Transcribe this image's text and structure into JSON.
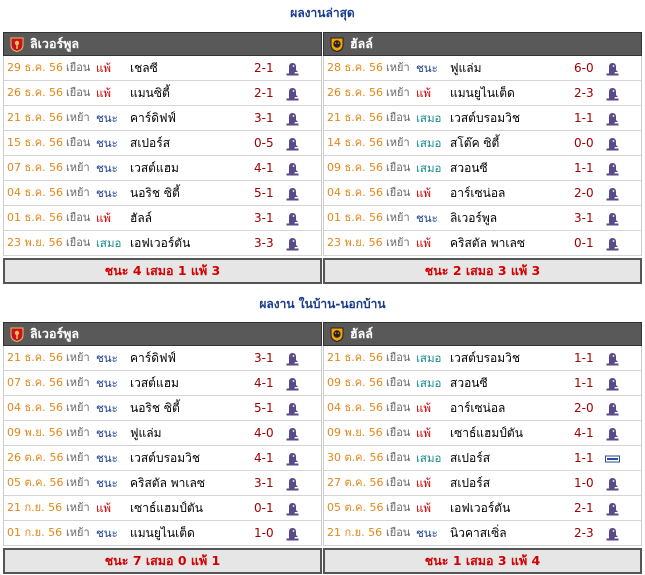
{
  "colors": {
    "title": "#1a3c8c",
    "header_bg": "#595959",
    "date": "#e0881a",
    "win": "#1a3c8c",
    "loss": "#d40000",
    "draw": "#1a8c8c",
    "score": "#a00000",
    "summary_text": "#d40000"
  },
  "sections": [
    {
      "title": "ผลงานล่าสุด",
      "panels": [
        {
          "team": "ลิเวอร์พูล",
          "crest_icon": "liverpool-crest-icon",
          "rows": [
            {
              "date": "29 ธ.ค. 56",
              "ha": "เยือน",
              "result": "แพ้",
              "type": "loss",
              "opponent": "เชลซี",
              "score": "2-1",
              "icon": "premier-league-icon"
            },
            {
              "date": "26 ธ.ค. 56",
              "ha": "เยือน",
              "result": "แพ้",
              "type": "loss",
              "opponent": "แมนซิตี้",
              "score": "2-1",
              "icon": "premier-league-icon"
            },
            {
              "date": "21 ธ.ค. 56",
              "ha": "เหย้า",
              "result": "ชนะ",
              "type": "win",
              "opponent": "คาร์ดิฟฟ์",
              "score": "3-1",
              "icon": "premier-league-icon"
            },
            {
              "date": "15 ธ.ค. 56",
              "ha": "เยือน",
              "result": "ชนะ",
              "type": "win",
              "opponent": "สเปอร์ส",
              "score": "0-5",
              "icon": "premier-league-icon"
            },
            {
              "date": "07 ธ.ค. 56",
              "ha": "เหย้า",
              "result": "ชนะ",
              "type": "win",
              "opponent": "เวสต์แฮม",
              "score": "4-1",
              "icon": "premier-league-icon"
            },
            {
              "date": "04 ธ.ค. 56",
              "ha": "เหย้า",
              "result": "ชนะ",
              "type": "win",
              "opponent": "นอริช ซิตี้",
              "score": "5-1",
              "icon": "premier-league-icon"
            },
            {
              "date": "01 ธ.ค. 56",
              "ha": "เยือน",
              "result": "แพ้",
              "type": "loss",
              "opponent": "ฮัลล์",
              "score": "3-1",
              "icon": "premier-league-icon"
            },
            {
              "date": "23 พ.ย. 56",
              "ha": "เยือน",
              "result": "เสมอ",
              "type": "draw",
              "opponent": "เอฟเวอร์ตัน",
              "score": "3-3",
              "icon": "premier-league-icon"
            }
          ],
          "summary": "ชนะ 4 เสมอ 1 แพ้ 3"
        },
        {
          "team": "ฮัลล์",
          "crest_icon": "hull-crest-icon",
          "rows": [
            {
              "date": "28 ธ.ค. 56",
              "ha": "เหย้า",
              "result": "ชนะ",
              "type": "win",
              "opponent": "ฟูแล่ม",
              "score": "6-0",
              "icon": "premier-league-icon"
            },
            {
              "date": "26 ธ.ค. 56",
              "ha": "เหย้า",
              "result": "แพ้",
              "type": "loss",
              "opponent": "แมนยูไนเต็ด",
              "score": "2-3",
              "icon": "premier-league-icon"
            },
            {
              "date": "21 ธ.ค. 56",
              "ha": "เยือน",
              "result": "เสมอ",
              "type": "draw",
              "opponent": "เวสต์บรอมวิช",
              "score": "1-1",
              "icon": "premier-league-icon"
            },
            {
              "date": "14 ธ.ค. 56",
              "ha": "เหย้า",
              "result": "เสมอ",
              "type": "draw",
              "opponent": "สโต๊ค ซิตี้",
              "score": "0-0",
              "icon": "premier-league-icon"
            },
            {
              "date": "09 ธ.ค. 56",
              "ha": "เยือน",
              "result": "เสมอ",
              "type": "draw",
              "opponent": "สวอนซี",
              "score": "1-1",
              "icon": "premier-league-icon"
            },
            {
              "date": "04 ธ.ค. 56",
              "ha": "เยือน",
              "result": "แพ้",
              "type": "loss",
              "opponent": "อาร์เซน่อล",
              "score": "2-0",
              "icon": "premier-league-icon"
            },
            {
              "date": "01 ธ.ค. 56",
              "ha": "เหย้า",
              "result": "ชนะ",
              "type": "win",
              "opponent": "ลิเวอร์พูล",
              "score": "3-1",
              "icon": "premier-league-icon"
            },
            {
              "date": "23 พ.ย. 56",
              "ha": "เหย้า",
              "result": "แพ้",
              "type": "loss",
              "opponent": "คริสตัล พาเลซ",
              "score": "0-1",
              "icon": "premier-league-icon"
            }
          ],
          "summary": "ชนะ 2 เสมอ 3 แพ้ 3"
        }
      ]
    },
    {
      "title": "ผลงาน ในบ้าน-นอกบ้าน",
      "panels": [
        {
          "team": "ลิเวอร์พูล",
          "crest_icon": "liverpool-crest-icon",
          "rows": [
            {
              "date": "21 ธ.ค. 56",
              "ha": "เหย้า",
              "result": "ชนะ",
              "type": "win",
              "opponent": "คาร์ดิฟฟ์",
              "score": "3-1",
              "icon": "premier-league-icon"
            },
            {
              "date": "07 ธ.ค. 56",
              "ha": "เหย้า",
              "result": "ชนะ",
              "type": "win",
              "opponent": "เวสต์แฮม",
              "score": "4-1",
              "icon": "premier-league-icon"
            },
            {
              "date": "04 ธ.ค. 56",
              "ha": "เหย้า",
              "result": "ชนะ",
              "type": "win",
              "opponent": "นอริช ซิตี้",
              "score": "5-1",
              "icon": "premier-league-icon"
            },
            {
              "date": "09 พ.ย. 56",
              "ha": "เหย้า",
              "result": "ชนะ",
              "type": "win",
              "opponent": "ฟูแล่ม",
              "score": "4-0",
              "icon": "premier-league-icon"
            },
            {
              "date": "26 ต.ค. 56",
              "ha": "เหย้า",
              "result": "ชนะ",
              "type": "win",
              "opponent": "เวสต์บรอมวิช",
              "score": "4-1",
              "icon": "premier-league-icon"
            },
            {
              "date": "05 ต.ค. 56",
              "ha": "เหย้า",
              "result": "ชนะ",
              "type": "win",
              "opponent": "คริสตัล พาเลซ",
              "score": "3-1",
              "icon": "premier-league-icon"
            },
            {
              "date": "21 ก.ย. 56",
              "ha": "เหย้า",
              "result": "แพ้",
              "type": "loss",
              "opponent": "เซาธ์แฮมป์ตัน",
              "score": "0-1",
              "icon": "premier-league-icon"
            },
            {
              "date": "01 ก.ย. 56",
              "ha": "เหย้า",
              "result": "ชนะ",
              "type": "win",
              "opponent": "แมนยูไนเต็ด",
              "score": "1-0",
              "icon": "premier-league-icon"
            }
          ],
          "summary": "ชนะ 7 เสมอ 0 แพ้ 1"
        },
        {
          "team": "ฮัลล์",
          "crest_icon": "hull-crest-icon",
          "rows": [
            {
              "date": "21 ธ.ค. 56",
              "ha": "เยือน",
              "result": "เสมอ",
              "type": "draw",
              "opponent": "เวสต์บรอมวิช",
              "score": "1-1",
              "icon": "premier-league-icon"
            },
            {
              "date": "09 ธ.ค. 56",
              "ha": "เยือน",
              "result": "เสมอ",
              "type": "draw",
              "opponent": "สวอนซี",
              "score": "1-1",
              "icon": "premier-league-icon"
            },
            {
              "date": "04 ธ.ค. 56",
              "ha": "เยือน",
              "result": "แพ้",
              "type": "loss",
              "opponent": "อาร์เซน่อล",
              "score": "2-0",
              "icon": "premier-league-icon"
            },
            {
              "date": "09 พ.ย. 56",
              "ha": "เยือน",
              "result": "แพ้",
              "type": "loss",
              "opponent": "เซาธ์แฮมป์ตัน",
              "score": "4-1",
              "icon": "premier-league-icon"
            },
            {
              "date": "30 ต.ค. 56",
              "ha": "เยือน",
              "result": "เสมอ",
              "type": "draw",
              "opponent": "สเปอร์ส",
              "score": "1-1",
              "icon": "league-cup-icon"
            },
            {
              "date": "27 ต.ค. 56",
              "ha": "เยือน",
              "result": "แพ้",
              "type": "loss",
              "opponent": "สเปอร์ส",
              "score": "1-0",
              "icon": "premier-league-icon"
            },
            {
              "date": "05 ต.ค. 56",
              "ha": "เยือน",
              "result": "แพ้",
              "type": "loss",
              "opponent": "เอฟเวอร์ตัน",
              "score": "2-1",
              "icon": "premier-league-icon"
            },
            {
              "date": "21 ก.ย. 56",
              "ha": "เยือน",
              "result": "ชนะ",
              "type": "win",
              "opponent": "นิวคาสเซิ่ล",
              "score": "2-3",
              "icon": "premier-league-icon"
            }
          ],
          "summary": "ชนะ 1 เสมอ 3 แพ้ 4"
        }
      ]
    }
  ]
}
